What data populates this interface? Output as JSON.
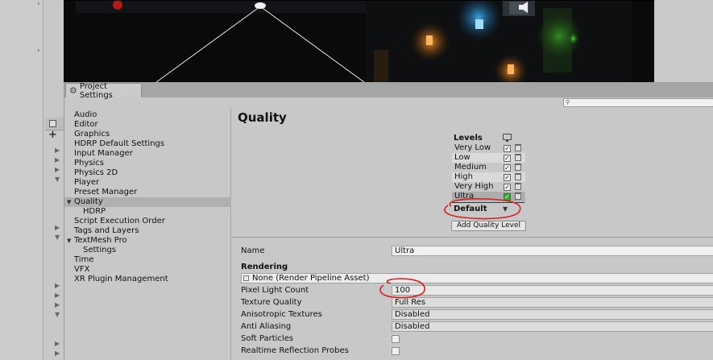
{
  "window": {
    "title": "Project Settings",
    "search_placeholder": ""
  },
  "sidebar": {
    "items": [
      {
        "label": "Audio"
      },
      {
        "label": "Editor"
      },
      {
        "label": "Graphics"
      },
      {
        "label": "HDRP Default Settings"
      },
      {
        "label": "Input Manager"
      },
      {
        "label": "Physics"
      },
      {
        "label": "Physics 2D"
      },
      {
        "label": "Player"
      },
      {
        "label": "Preset Manager"
      },
      {
        "label": "Quality",
        "selected": true,
        "expanded": true
      },
      {
        "label": "HDRP",
        "sub": true
      },
      {
        "label": "Script Execution Order"
      },
      {
        "label": "Tags and Layers"
      },
      {
        "label": "TextMesh Pro",
        "expanded": true
      },
      {
        "label": "Settings",
        "sub": true
      },
      {
        "label": "Time"
      },
      {
        "label": "VFX"
      },
      {
        "label": "XR Plugin Management"
      }
    ]
  },
  "quality": {
    "title": "Quality",
    "levels_header": "Levels",
    "levels": [
      {
        "name": "Very Low",
        "checked": true
      },
      {
        "name": "Low",
        "checked": true
      },
      {
        "name": "Medium",
        "checked": true
      },
      {
        "name": "High",
        "checked": true
      },
      {
        "name": "Very High",
        "checked": true
      },
      {
        "name": "Ultra",
        "checked": true,
        "selected": true
      }
    ],
    "default_label": "Default",
    "add_level_button": "Add Quality Level",
    "name_label": "Name",
    "name_value": "Ultra",
    "rendering_header": "Rendering",
    "pipeline_value": "None (Render Pipeline Asset)",
    "properties": [
      {
        "label": "Pixel Light Count",
        "value": "100",
        "kind": "text"
      },
      {
        "label": "Texture Quality",
        "value": "Full Res",
        "kind": "dropdown"
      },
      {
        "label": "Anisotropic Textures",
        "value": "Disabled",
        "kind": "dropdown"
      },
      {
        "label": "Anti Aliasing",
        "value": "Disabled",
        "kind": "dropdown"
      },
      {
        "label": "Soft Particles",
        "value": false,
        "kind": "checkbox"
      },
      {
        "label": "Realtime Reflection Probes",
        "value": false,
        "kind": "checkbox"
      }
    ]
  },
  "colors": {
    "annotation": "#d42020",
    "checkmark_green": "#3aa33a",
    "panel_bg": "#c8c8c8",
    "selection": "#b0b0b0"
  },
  "icons": {
    "window_tab": "gear-icon",
    "search": "search-icon",
    "levels_column": "monitor-icon",
    "level_delete": "trash-icon",
    "scene_sound": "speaker-icon"
  }
}
